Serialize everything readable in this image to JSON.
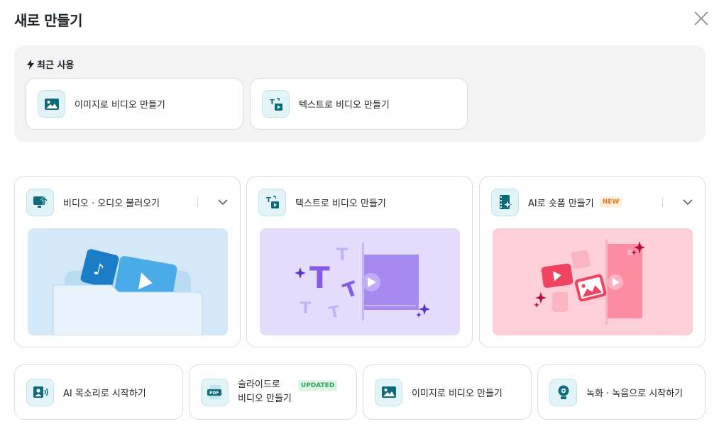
{
  "header": {
    "title": "새로 만들기"
  },
  "recent": {
    "label": "최근 사용",
    "items": [
      {
        "label": "이미지로 비디오 만들기",
        "icon": "image-icon"
      },
      {
        "label": "텍스트로 비디오 만들기",
        "icon": "text-to-video-icon"
      }
    ]
  },
  "cards": [
    {
      "label": "비디오 · 오디오 불러오기",
      "icon": "upload-icon",
      "has_dropdown": true
    },
    {
      "label": "텍스트로 비디오 만들기",
      "icon": "text-to-video-icon",
      "has_dropdown": false
    },
    {
      "label": "AI로 숏폼 만들기",
      "icon": "ai-shortform-icon",
      "badge": "NEW",
      "has_dropdown": true
    }
  ],
  "actions": [
    {
      "label": "AI 목소리로 시작하기",
      "icon": "ai-voice-icon"
    },
    {
      "label_line1": "슬라이드로",
      "label_line2": "비디오 만들기",
      "icon": "pdf-icon",
      "badge": "UPDATED"
    },
    {
      "label": "이미지로 비디오 만들기",
      "icon": "image-icon"
    },
    {
      "label": "녹화 · 녹음으로 시작하기",
      "icon": "webcam-icon"
    }
  ],
  "colors": {
    "accent_teal": "#0e6b7a",
    "icon_bg": "#e3f4f9",
    "new_badge": "#e0782a",
    "updated_badge": "#2fa25a"
  }
}
